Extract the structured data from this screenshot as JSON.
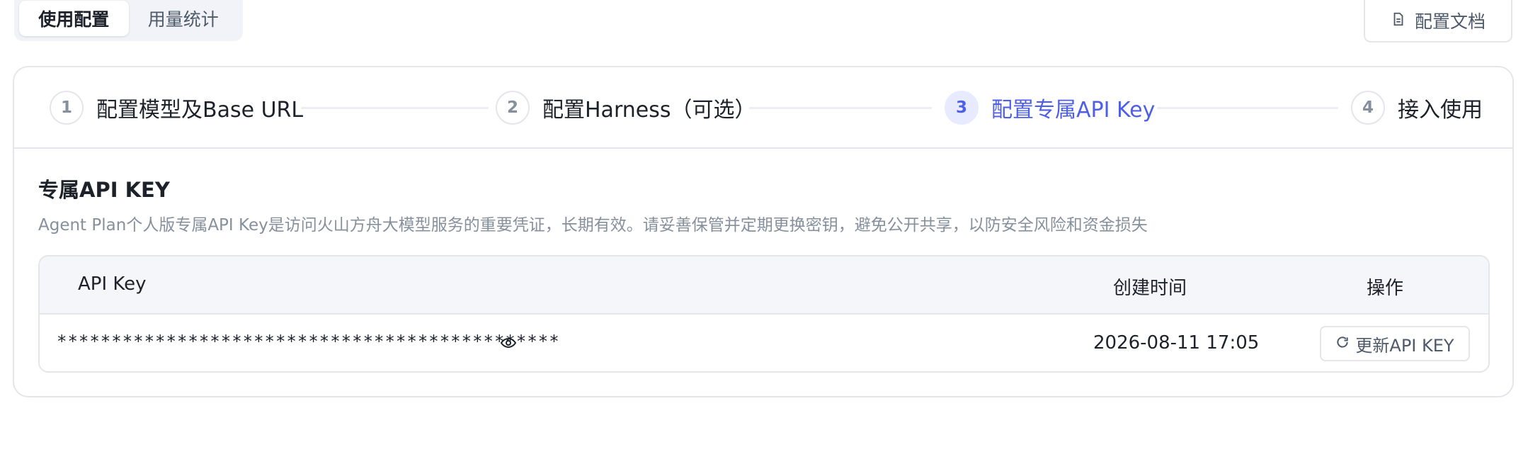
{
  "tabs": [
    {
      "label": "使用配置",
      "active": true
    },
    {
      "label": "用量统计",
      "active": false
    }
  ],
  "doc_button": {
    "label": "配置文档",
    "icon": "document-icon"
  },
  "steps": [
    {
      "number": "1",
      "label": "配置模型及Base URL",
      "active": false
    },
    {
      "number": "2",
      "label": "配置Harness（可选）",
      "active": false
    },
    {
      "number": "3",
      "label": "配置专属API Key",
      "active": true
    },
    {
      "number": "4",
      "label": "接入使用",
      "active": false
    }
  ],
  "section": {
    "title": "专属API KEY",
    "description": "Agent Plan个人版专属API Key是访问火山方舟大模型服务的重要凭证，长期有效。请妥善保管并定期更换密钥，避免公开共享，以防安全风险和资金损失"
  },
  "table": {
    "headers": {
      "api_key": "API Key",
      "created": "创建时间",
      "actions": "操作"
    },
    "rows": [
      {
        "api_key": "**********************************************",
        "eye_icon": "eye-icon",
        "created": "2026-08-11 17:05",
        "action_label": "更新API KEY",
        "action_icon": "refresh-icon"
      }
    ]
  },
  "colors": {
    "accent": "#4d5fe8",
    "accent_bg": "#e8ebff",
    "border": "#e5e6eb",
    "muted_text": "#86909c"
  }
}
